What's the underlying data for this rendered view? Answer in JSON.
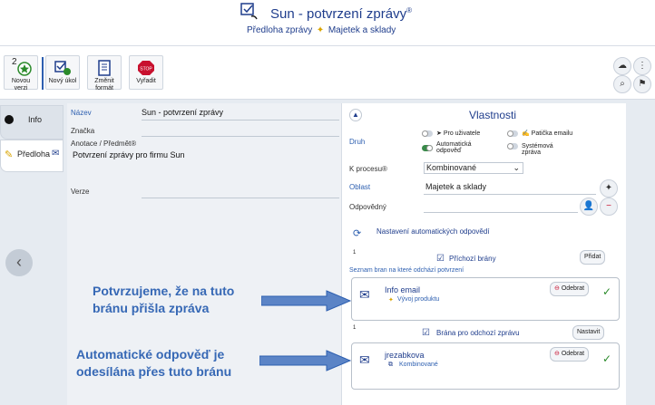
{
  "header": {
    "title": "Sun - potvrzení zprávy",
    "title_mark": "®",
    "template": "Předloha zprávy",
    "area": "Majetek a sklady"
  },
  "toolbar": {
    "version_count": "2",
    "new_version": "Novou verzi",
    "new_task": "Nový úkol",
    "change_format": "Změnit formát",
    "discard": "Vyřadit"
  },
  "sidebar": {
    "tabs": [
      "Info",
      "Předloha"
    ]
  },
  "form": {
    "name_label": "Název",
    "name_value": "Sun - potvrzení zprávy",
    "tag_label": "Značka",
    "annotation_label": "Anotace / Předmět®",
    "annotation_value": "Potvrzení zprávy pro firmu Sun",
    "version_label": "Verze"
  },
  "panel": {
    "title": "Vlastnosti",
    "kind_label": "Druh",
    "kind_options": [
      "Pro uživatele",
      "Patička emailu",
      "Automatická odpověď",
      "Systémová zpráva"
    ],
    "process_label": "K procesu®",
    "process_value": "Kombinované",
    "area_label": "Oblast",
    "area_value": "Majetek a sklady",
    "responsible_label": "Odpovědný",
    "auto_settings": "Nastavení automatických odpovědí",
    "incoming_count": "1",
    "incoming_title": "Příchozí brány",
    "add_button": "Přidat",
    "gates_list_label": "Seznam bran na které odchází potvrzení",
    "incoming_gate": {
      "name": "Info email",
      "sub": "Vývoj produktu",
      "remove": "Odebrat"
    },
    "outgoing_count": "1",
    "outgoing_title": "Brána pro odchozí zprávu",
    "set_button": "Nastavit",
    "outgoing_gate": {
      "name": "jrezabkova",
      "sub": "Kombinované",
      "remove": "Odebrat"
    }
  },
  "callouts": {
    "first_line1": "Potvrzujeme, že na tuto",
    "first_line2": "bránu přišla zpráva",
    "second_line1": "Automatické odpověď je",
    "second_line2": "odesílána přes tuto bránu"
  },
  "colors": {
    "accent": "#1f3d8c",
    "callout": "#3668b5",
    "arrow": "#5b84c6"
  }
}
